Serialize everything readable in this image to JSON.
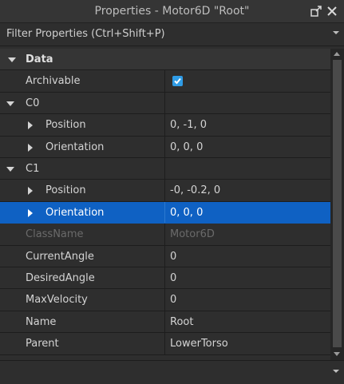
{
  "window": {
    "title": "Properties - Motor6D \"Root\"",
    "icons": [
      "undock-icon",
      "close-icon"
    ]
  },
  "filter": {
    "placeholder": "Filter Properties (Ctrl+Shift+P)"
  },
  "colors": {
    "selection": "#0f61c3",
    "checkbox": "#2f9ce6",
    "background": "#2e2e2e"
  },
  "properties": {
    "data_section": "Data",
    "archivable": {
      "label": "Archivable",
      "checked": true
    },
    "c0": {
      "label": "C0",
      "position": {
        "label": "Position",
        "value": "0, -1, 0"
      },
      "orientation": {
        "label": "Orientation",
        "value": "0, 0, 0"
      }
    },
    "c1": {
      "label": "C1",
      "position": {
        "label": "Position",
        "value": "-0, -0.2, 0"
      },
      "orientation": {
        "label": "Orientation",
        "value": "0, 0, 0"
      }
    },
    "classname": {
      "label": "ClassName",
      "value": "Motor6D"
    },
    "current_angle": {
      "label": "CurrentAngle",
      "value": "0"
    },
    "desired_angle": {
      "label": "DesiredAngle",
      "value": "0"
    },
    "max_velocity": {
      "label": "MaxVelocity",
      "value": "0"
    },
    "name": {
      "label": "Name",
      "value": "Root"
    },
    "parent": {
      "label": "Parent",
      "value": "LowerTorso"
    }
  }
}
